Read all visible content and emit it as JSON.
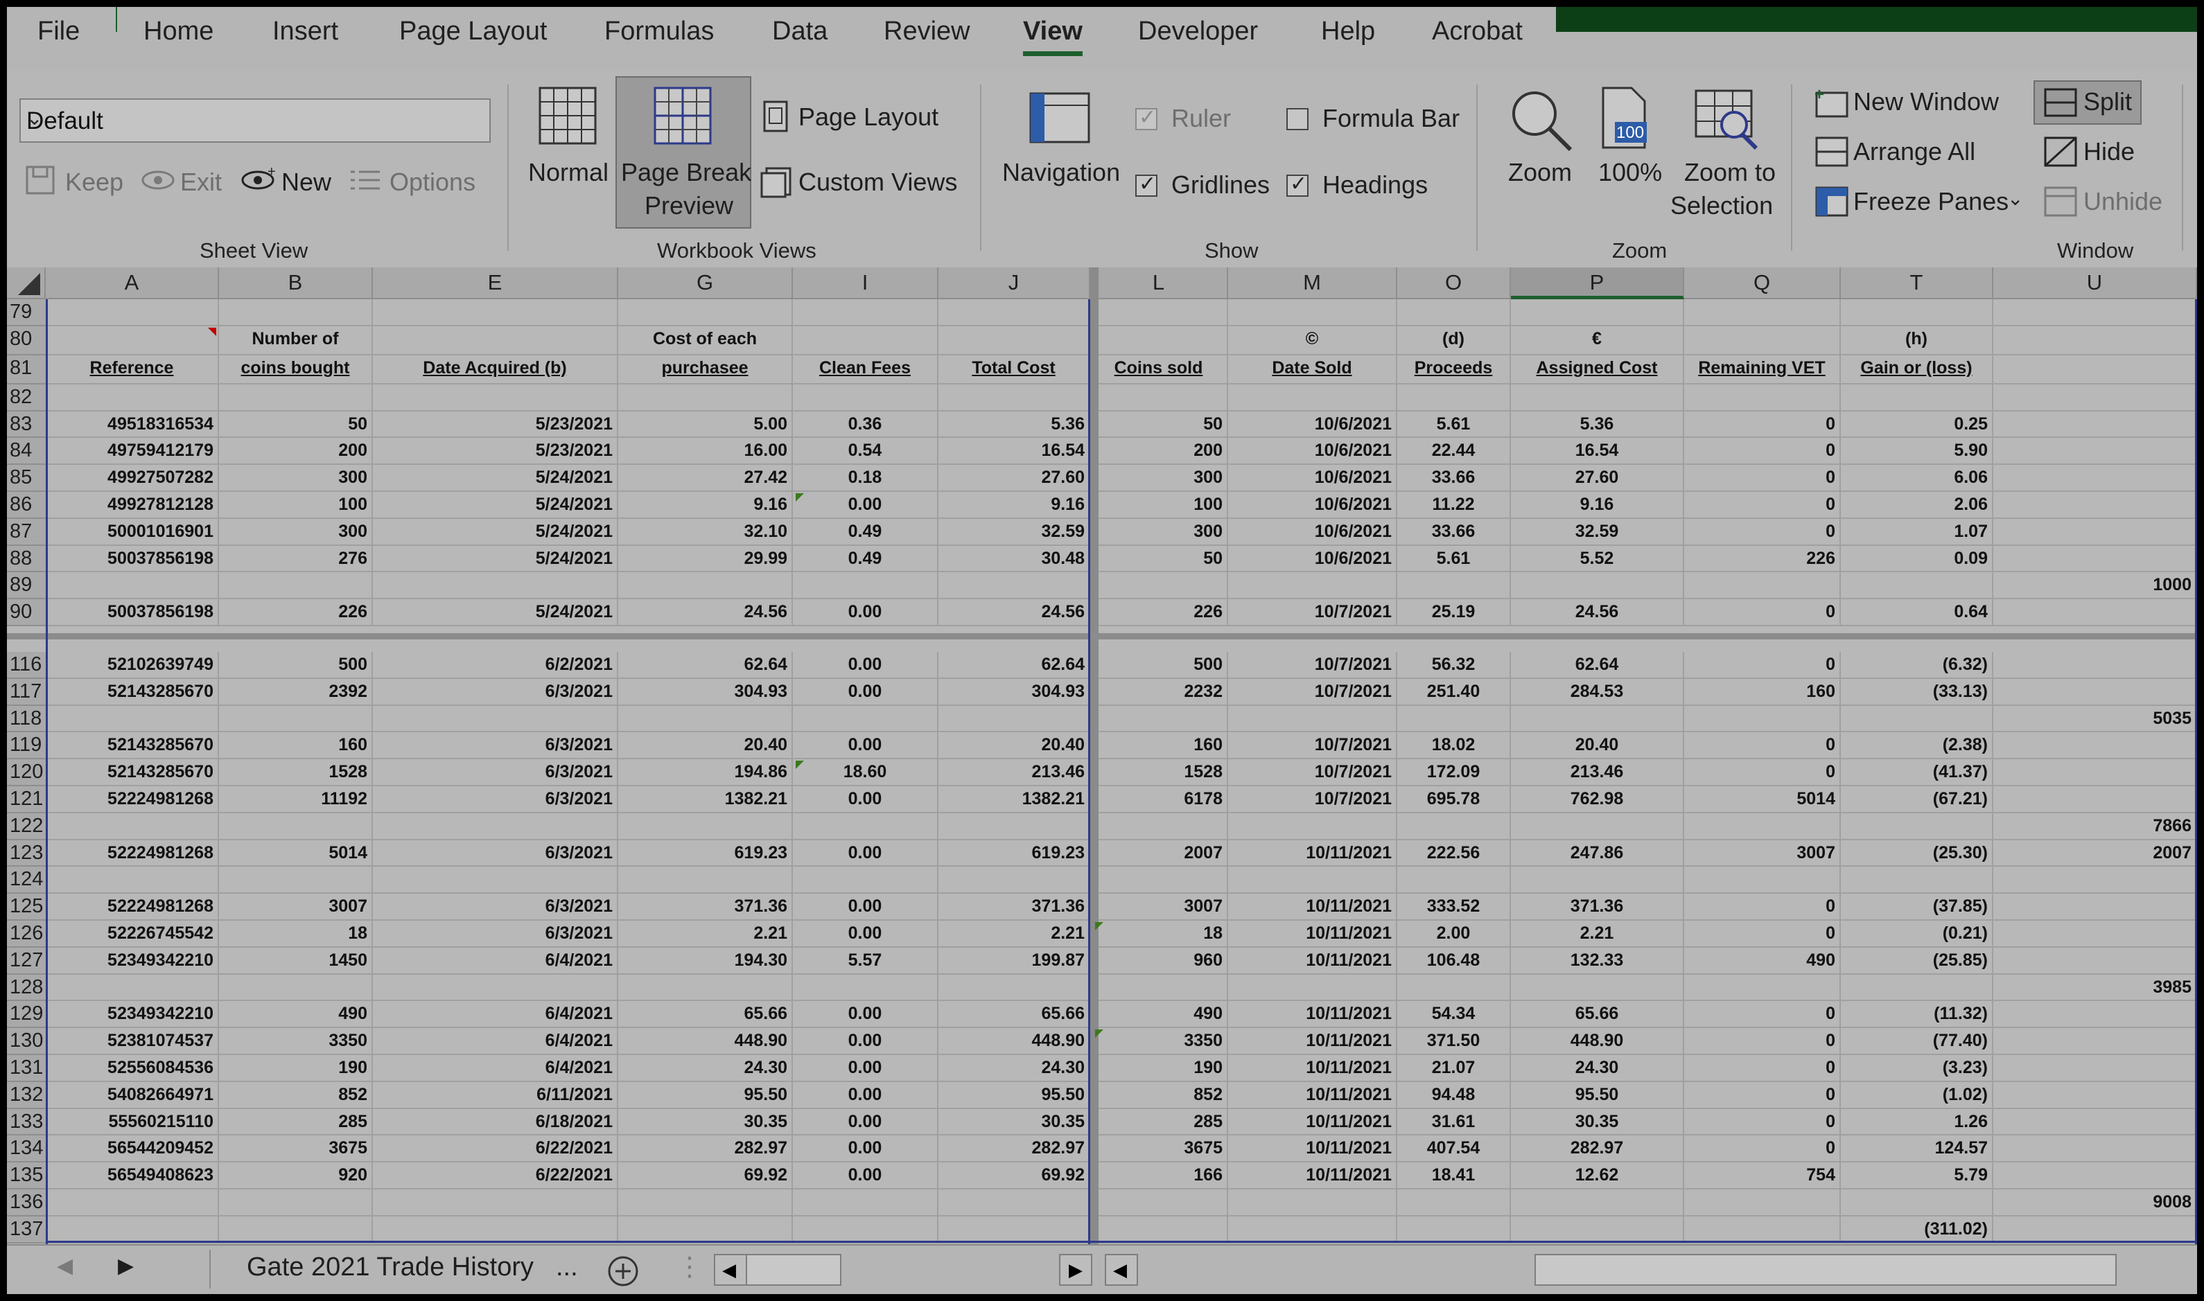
{
  "tabs": [
    "File",
    "Home",
    "Insert",
    "Page Layout",
    "Formulas",
    "Data",
    "Review",
    "View",
    "Developer",
    "Help",
    "Acrobat"
  ],
  "active_tab": "View",
  "ribbon": {
    "sheet_view": {
      "dropdown_value": "Default",
      "keep": "Keep",
      "exit": "Exit",
      "new": "New",
      "options": "Options",
      "label": "Sheet View"
    },
    "workbook_views": {
      "normal": "Normal",
      "page_break_1": "Page Break",
      "page_break_2": "Preview",
      "page_layout": "Page Layout",
      "custom_views": "Custom Views",
      "label": "Workbook Views"
    },
    "show": {
      "navigation": "Navigation",
      "ruler": "Ruler",
      "gridlines": "Gridlines",
      "formula_bar": "Formula Bar",
      "headings": "Headings",
      "label": "Show"
    },
    "zoom": {
      "zoom": "Zoom",
      "hundred": "100%",
      "icon_100": "100",
      "zoom_sel_1": "Zoom to",
      "zoom_sel_2": "Selection",
      "label": "Zoom"
    },
    "window": {
      "new_window": "New Window",
      "arrange_all": "Arrange All",
      "freeze_panes": "Freeze Panes",
      "split": "Split",
      "hide": "Hide",
      "unhide": "Unhide",
      "label": "Window"
    }
  },
  "columns": [
    "A",
    "B",
    "E",
    "G",
    "I",
    "J",
    "L",
    "M",
    "O",
    "P",
    "Q",
    "T",
    "U"
  ],
  "rows": [
    {
      "n": "79",
      "c": [
        "",
        "",
        "",
        "",
        "",
        "",
        "",
        "",
        "",
        "",
        "",
        "",
        ""
      ]
    },
    {
      "n": "80",
      "c": [
        "",
        "Number of",
        "",
        "Cost of each",
        "",
        "",
        "",
        "©",
        "(d)",
        "€",
        "",
        "(h)",
        ""
      ]
    },
    {
      "n": "81",
      "c": [
        "Reference",
        "coins bought",
        "Date Acquired (b)",
        "purchasee",
        "Clean Fees",
        "Total Cost",
        "Coins sold",
        "Date Sold",
        "Proceeds",
        "Assigned Cost",
        "Remaining VET",
        "Gain or (loss)",
        ""
      ]
    },
    {
      "n": "82",
      "c": [
        "",
        "",
        "",
        "",
        "",
        "",
        "",
        "",
        "",
        "",
        "",
        "",
        ""
      ]
    },
    {
      "n": "83",
      "c": [
        "49518316534",
        "50",
        "5/23/2021",
        "5.00",
        "0.36",
        "5.36",
        "50",
        "10/6/2021",
        "5.61",
        "5.36",
        "0",
        "0.25",
        ""
      ]
    },
    {
      "n": "84",
      "c": [
        "49759412179",
        "200",
        "5/23/2021",
        "16.00",
        "0.54",
        "16.54",
        "200",
        "10/6/2021",
        "22.44",
        "16.54",
        "0",
        "5.90",
        ""
      ]
    },
    {
      "n": "85",
      "c": [
        "49927507282",
        "300",
        "5/24/2021",
        "27.42",
        "0.18",
        "27.60",
        "300",
        "10/6/2021",
        "33.66",
        "27.60",
        "0",
        "6.06",
        ""
      ]
    },
    {
      "n": "86",
      "c": [
        "49927812128",
        "100",
        "5/24/2021",
        "9.16",
        "0.00",
        "9.16",
        "100",
        "10/6/2021",
        "11.22",
        "9.16",
        "0",
        "2.06",
        ""
      ]
    },
    {
      "n": "87",
      "c": [
        "50001016901",
        "300",
        "5/24/2021",
        "32.10",
        "0.49",
        "32.59",
        "300",
        "10/6/2021",
        "33.66",
        "32.59",
        "0",
        "1.07",
        ""
      ]
    },
    {
      "n": "88",
      "c": [
        "50037856198",
        "276",
        "5/24/2021",
        "29.99",
        "0.49",
        "30.48",
        "50",
        "10/6/2021",
        "5.61",
        "5.52",
        "226",
        "0.09",
        ""
      ]
    },
    {
      "n": "89",
      "c": [
        "",
        "",
        "",
        "",
        "",
        "",
        "",
        "",
        "",
        "",
        "",
        "",
        "1000"
      ]
    },
    {
      "n": "90",
      "c": [
        "50037856198",
        "226",
        "5/24/2021",
        "24.56",
        "0.00",
        "24.56",
        "226",
        "10/7/2021",
        "25.19",
        "24.56",
        "0",
        "0.64",
        ""
      ]
    },
    {
      "n": "116",
      "c": [
        "52102639749",
        "500",
        "6/2/2021",
        "62.64",
        "0.00",
        "62.64",
        "500",
        "10/7/2021",
        "56.32",
        "62.64",
        "0",
        "(6.32)",
        ""
      ]
    },
    {
      "n": "117",
      "c": [
        "52143285670",
        "2392",
        "6/3/2021",
        "304.93",
        "0.00",
        "304.93",
        "2232",
        "10/7/2021",
        "251.40",
        "284.53",
        "160",
        "(33.13)",
        ""
      ]
    },
    {
      "n": "118",
      "c": [
        "",
        "",
        "",
        "",
        "",
        "",
        "",
        "",
        "",
        "",
        "",
        "",
        "5035"
      ]
    },
    {
      "n": "119",
      "c": [
        "52143285670",
        "160",
        "6/3/2021",
        "20.40",
        "0.00",
        "20.40",
        "160",
        "10/7/2021",
        "18.02",
        "20.40",
        "0",
        "(2.38)",
        ""
      ]
    },
    {
      "n": "120",
      "c": [
        "52143285670",
        "1528",
        "6/3/2021",
        "194.86",
        "18.60",
        "213.46",
        "1528",
        "10/7/2021",
        "172.09",
        "213.46",
        "0",
        "(41.37)",
        ""
      ]
    },
    {
      "n": "121",
      "c": [
        "52224981268",
        "11192",
        "6/3/2021",
        "1382.21",
        "0.00",
        "1382.21",
        "6178",
        "10/7/2021",
        "695.78",
        "762.98",
        "5014",
        "(67.21)",
        ""
      ]
    },
    {
      "n": "122",
      "c": [
        "",
        "",
        "",
        "",
        "",
        "",
        "",
        "",
        "",
        "",
        "",
        "",
        "7866"
      ]
    },
    {
      "n": "123",
      "c": [
        "52224981268",
        "5014",
        "6/3/2021",
        "619.23",
        "0.00",
        "619.23",
        "2007",
        "10/11/2021",
        "222.56",
        "247.86",
        "3007",
        "(25.30)",
        "2007"
      ]
    },
    {
      "n": "124",
      "c": [
        "",
        "",
        "",
        "",
        "",
        "",
        "",
        "",
        "",
        "",
        "",
        "",
        ""
      ]
    },
    {
      "n": "125",
      "c": [
        "52224981268",
        "3007",
        "6/3/2021",
        "371.36",
        "0.00",
        "371.36",
        "3007",
        "10/11/2021",
        "333.52",
        "371.36",
        "0",
        "(37.85)",
        ""
      ]
    },
    {
      "n": "126",
      "c": [
        "52226745542",
        "18",
        "6/3/2021",
        "2.21",
        "0.00",
        "2.21",
        "18",
        "10/11/2021",
        "2.00",
        "2.21",
        "0",
        "(0.21)",
        ""
      ]
    },
    {
      "n": "127",
      "c": [
        "52349342210",
        "1450",
        "6/4/2021",
        "194.30",
        "5.57",
        "199.87",
        "960",
        "10/11/2021",
        "106.48",
        "132.33",
        "490",
        "(25.85)",
        ""
      ]
    },
    {
      "n": "128",
      "c": [
        "",
        "",
        "",
        "",
        "",
        "",
        "",
        "",
        "",
        "",
        "",
        "",
        "3985"
      ]
    },
    {
      "n": "129",
      "c": [
        "52349342210",
        "490",
        "6/4/2021",
        "65.66",
        "0.00",
        "65.66",
        "490",
        "10/11/2021",
        "54.34",
        "65.66",
        "0",
        "(11.32)",
        ""
      ]
    },
    {
      "n": "130",
      "c": [
        "52381074537",
        "3350",
        "6/4/2021",
        "448.90",
        "0.00",
        "448.90",
        "3350",
        "10/11/2021",
        "371.50",
        "448.90",
        "0",
        "(77.40)",
        ""
      ]
    },
    {
      "n": "131",
      "c": [
        "52556084536",
        "190",
        "6/4/2021",
        "24.30",
        "0.00",
        "24.30",
        "190",
        "10/11/2021",
        "21.07",
        "24.30",
        "0",
        "(3.23)",
        ""
      ]
    },
    {
      "n": "132",
      "c": [
        "54082664971",
        "852",
        "6/11/2021",
        "95.50",
        "0.00",
        "95.50",
        "852",
        "10/11/2021",
        "94.48",
        "95.50",
        "0",
        "(1.02)",
        ""
      ]
    },
    {
      "n": "133",
      "c": [
        "55560215110",
        "285",
        "6/18/2021",
        "30.35",
        "0.00",
        "30.35",
        "285",
        "10/11/2021",
        "31.61",
        "30.35",
        "0",
        "1.26",
        ""
      ]
    },
    {
      "n": "134",
      "c": [
        "56544209452",
        "3675",
        "6/22/2021",
        "282.97",
        "0.00",
        "282.97",
        "3675",
        "10/11/2021",
        "407.54",
        "282.97",
        "0",
        "124.57",
        ""
      ]
    },
    {
      "n": "135",
      "c": [
        "56549408623",
        "920",
        "6/22/2021",
        "69.92",
        "0.00",
        "69.92",
        "166",
        "10/11/2021",
        "18.41",
        "12.62",
        "754",
        "5.79",
        ""
      ]
    },
    {
      "n": "136",
      "c": [
        "",
        "",
        "",
        "",
        "",
        "",
        "",
        "",
        "",
        "",
        "",
        "",
        "9008"
      ]
    },
    {
      "n": "137",
      "c": [
        "",
        "",
        "",
        "",
        "",
        "",
        "",
        "",
        "",
        "",
        "",
        "(311.02)",
        ""
      ]
    }
  ],
  "sheet_tab": "Gate 2021 Trade History",
  "sheet_tab_more": "...",
  "colors": {
    "accent_green": "#1d5f2d",
    "page_break_blue": "#2d3a8a"
  }
}
